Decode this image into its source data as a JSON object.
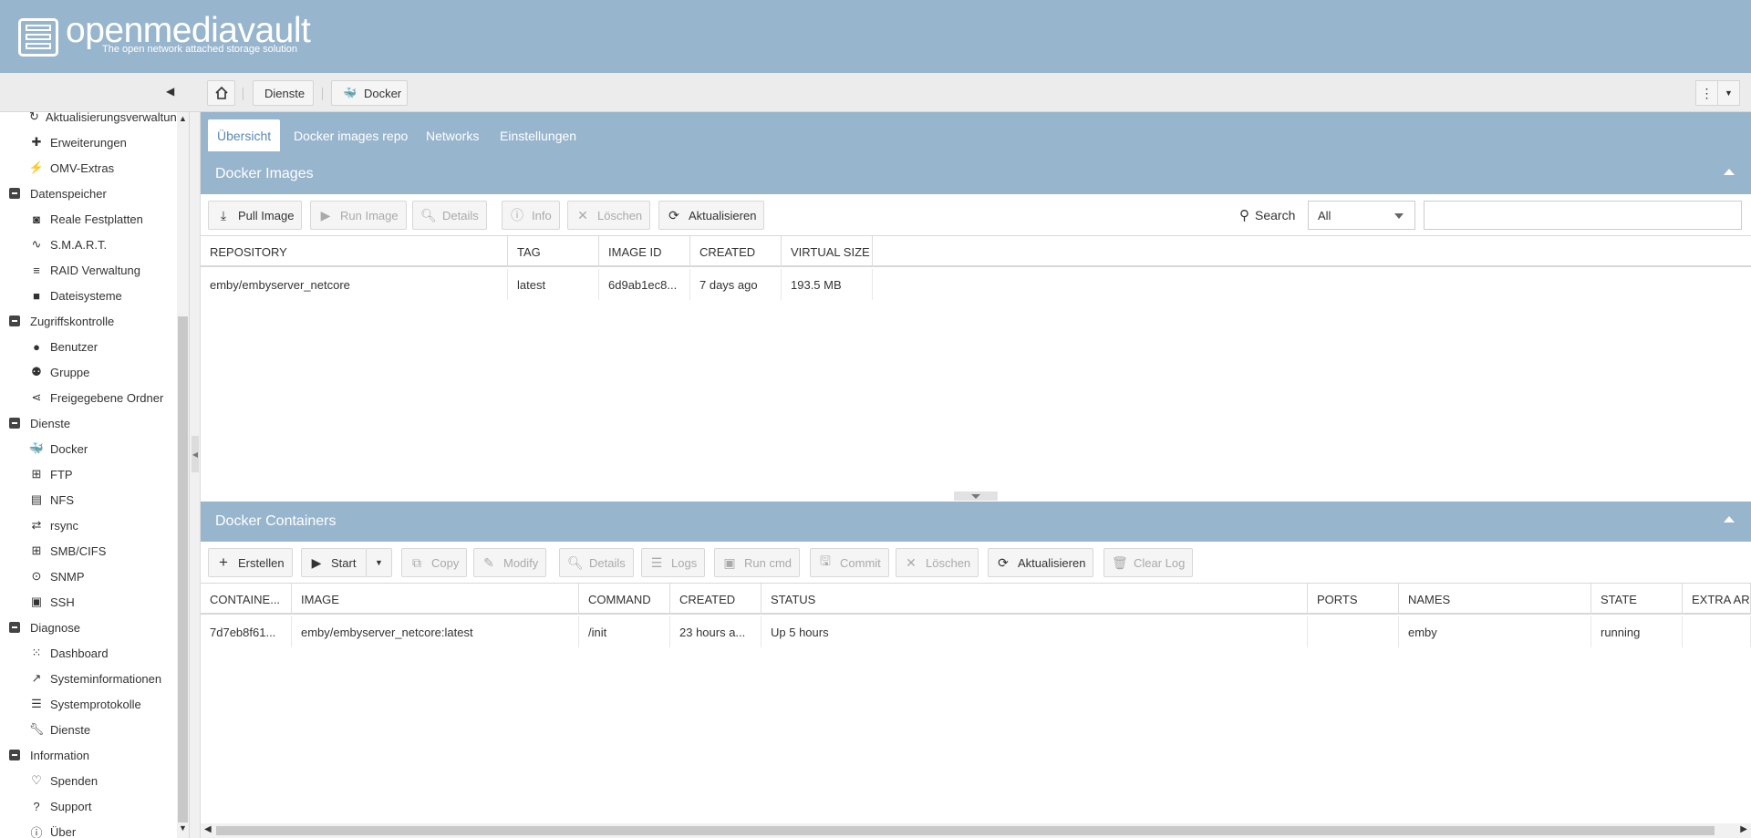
{
  "app": {
    "brand": "openmediavault",
    "tagline": "The open network attached storage solution"
  },
  "breadcrumb": {
    "items": [
      "Dienste",
      "Docker"
    ]
  },
  "sidebar": {
    "items": [
      {
        "type": "child",
        "label": "Aktualisierungsverwaltung",
        "icon": "update-icon"
      },
      {
        "type": "child",
        "label": "Erweiterungen",
        "icon": "puzzle-icon"
      },
      {
        "type": "child",
        "label": "OMV-Extras",
        "icon": "plug-icon"
      },
      {
        "type": "group",
        "label": "Datenspeicher"
      },
      {
        "type": "child",
        "label": "Reale Festplatten",
        "icon": "disk-icon"
      },
      {
        "type": "child",
        "label": "S.M.A.R.T.",
        "icon": "pulse-icon"
      },
      {
        "type": "child",
        "label": "RAID Verwaltung",
        "icon": "stack-icon"
      },
      {
        "type": "child",
        "label": "Dateisysteme",
        "icon": "folder-icon"
      },
      {
        "type": "group",
        "label": "Zugriffskontrolle"
      },
      {
        "type": "child",
        "label": "Benutzer",
        "icon": "user-icon"
      },
      {
        "type": "child",
        "label": "Gruppe",
        "icon": "group-icon"
      },
      {
        "type": "child",
        "label": "Freigegebene Ordner",
        "icon": "share-icon"
      },
      {
        "type": "group",
        "label": "Dienste"
      },
      {
        "type": "child",
        "label": "Docker",
        "icon": "docker-icon"
      },
      {
        "type": "child",
        "label": "FTP",
        "icon": "ftp-icon"
      },
      {
        "type": "child",
        "label": "NFS",
        "icon": "nfs-icon"
      },
      {
        "type": "child",
        "label": "rsync",
        "icon": "rsync-icon"
      },
      {
        "type": "child",
        "label": "SMB/CIFS",
        "icon": "windows-icon"
      },
      {
        "type": "child",
        "label": "SNMP",
        "icon": "snmp-icon"
      },
      {
        "type": "child",
        "label": "SSH",
        "icon": "terminal-icon"
      },
      {
        "type": "group",
        "label": "Diagnose"
      },
      {
        "type": "child",
        "label": "Dashboard",
        "icon": "dashboard-icon"
      },
      {
        "type": "child",
        "label": "Systeminformationen",
        "icon": "chart-line-icon"
      },
      {
        "type": "child",
        "label": "Systemprotokolle",
        "icon": "log-icon"
      },
      {
        "type": "child",
        "label": "Dienste",
        "icon": "wrench-icon"
      },
      {
        "type": "group",
        "label": "Information"
      },
      {
        "type": "child",
        "label": "Spenden",
        "icon": "heart-icon"
      },
      {
        "type": "child",
        "label": "Support",
        "icon": "question-icon"
      },
      {
        "type": "child",
        "label": "Über",
        "icon": "info-icon"
      }
    ]
  },
  "tabs": [
    "Übersicht",
    "Docker images repo",
    "Networks",
    "Einstellungen"
  ],
  "images_panel": {
    "title": "Docker Images",
    "buttons": [
      "Pull Image",
      "Run Image",
      "Details",
      "Info",
      "Löschen",
      "Aktualisieren"
    ],
    "search_label": "Search",
    "search_filter": "All",
    "search_value": "",
    "columns": [
      "REPOSITORY",
      "TAG",
      "IMAGE ID",
      "CREATED",
      "VIRTUAL SIZE"
    ],
    "rows": [
      [
        "emby/embyserver_netcore",
        "latest",
        "6d9ab1ec8...",
        "7 days ago",
        "193.5 MB"
      ]
    ]
  },
  "containers_panel": {
    "title": "Docker Containers",
    "buttons": [
      "Erstellen",
      "Start",
      "Copy",
      "Modify",
      "Details",
      "Logs",
      "Run cmd",
      "Commit",
      "Löschen",
      "Aktualisieren",
      "Clear Log"
    ],
    "columns": [
      "CONTAINE...",
      "IMAGE",
      "COMMAND",
      "CREATED",
      "STATUS",
      "PORTS",
      "NAMES",
      "STATE",
      "EXTRA AR"
    ],
    "rows": [
      [
        "7d7eb8f61...",
        "emby/embyserver_netcore:latest",
        "/init",
        "23 hours a...",
        "Up 5 hours",
        "",
        "emby",
        "running",
        ""
      ]
    ]
  }
}
